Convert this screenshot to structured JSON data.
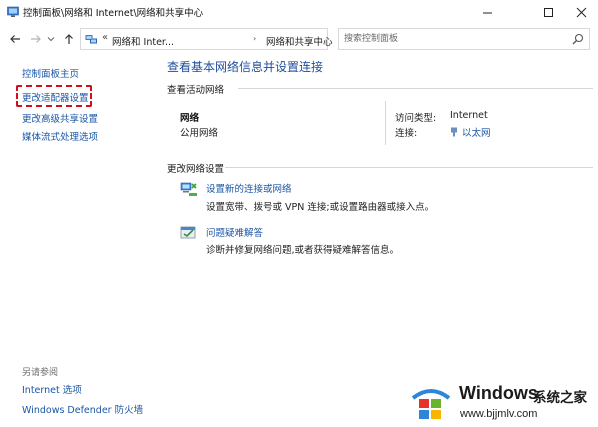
{
  "window": {
    "title": "控制面板\\网络和 Internet\\网络和共享中心",
    "minimize_icon": "minimize-icon",
    "maximize_icon": "maximize-icon",
    "close_icon": "close-icon"
  },
  "address": {
    "prefix": "«",
    "crumbs": [
      "网络和 Inter...",
      "网络和共享中心"
    ],
    "separator": "›"
  },
  "search": {
    "placeholder": "搜索控制面板"
  },
  "sidebar": {
    "items": [
      {
        "label": "控制面板主页"
      },
      {
        "label": "更改适配器设置",
        "highlighted": true
      },
      {
        "label": "更改高级共享设置"
      },
      {
        "label": "媒体流式处理选项"
      }
    ],
    "see_also_label": "另请参阅",
    "see_also": [
      {
        "label": "Internet 选项"
      },
      {
        "label": "Windows Defender 防火墙"
      }
    ]
  },
  "main": {
    "title": "查看基本网络信息并设置连接",
    "active_header": "查看活动网络",
    "network": {
      "name": "网络",
      "type": "公用网络",
      "access_label": "访问类型:",
      "access_value": "Internet",
      "connection_label": "连接:",
      "connection_value": "以太网"
    },
    "change_header": "更改网络设置",
    "tasks": [
      {
        "icon": "network-setup-icon",
        "link": "设置新的连接或网络",
        "desc": "设置宽带、拨号或 VPN 连接;或设置路由器或接入点。"
      },
      {
        "icon": "troubleshoot-icon",
        "link": "问题疑难解答",
        "desc": "诊断并修复网络问题,或者获得疑难解答信息。"
      }
    ]
  },
  "watermark": {
    "brand": "Windows",
    "cn": "系统之家",
    "url": "www.bjjmlv.com"
  }
}
